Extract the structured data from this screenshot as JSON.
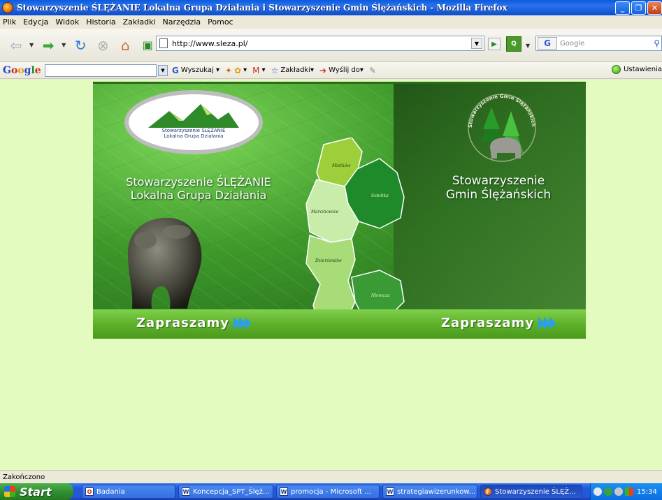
{
  "window": {
    "title": "Stowarzyszenie ŚLĘŻANIE Lokalna Grupa Działania i Stowarzyszenie Gmin Ślężańskich - Mozilla Firefox"
  },
  "menu": [
    "Plik",
    "Edycja",
    "Widok",
    "Historia",
    "Zakładki",
    "Narzędzia",
    "Pomoc"
  ],
  "navbar": {
    "url": "http://www.sleza.pl/",
    "search_placeholder": "Google"
  },
  "google_toolbar": {
    "logo": "Google",
    "search_label": "Wyszukaj",
    "bookmarks_label": "Zakładki",
    "send_label": "Wyślij do",
    "settings_label": "Ustawienia"
  },
  "banner": {
    "logo_text_line1": "Stowarzyszenie ŚLĘŻANIE",
    "logo_text_line2": "Lokalna  Grupa  Działania",
    "left_title_line1": "Stowarzyszenie ŚLĘŻANIE",
    "left_title_line2": "Lokalna  Grupa  Działania",
    "right_title_line1": "Stowarzyszenie",
    "right_title_line2": "Gmin Ślężańskich",
    "emblem_text": "Stowarzyszenie Gmin Ślężańskich",
    "map_labels": [
      "Mietków",
      "Sobótka",
      "Marcinowice",
      "Dzierżoniów",
      "Niemcza"
    ],
    "enter_left": "Zapraszamy",
    "enter_right": "Zapraszamy"
  },
  "status": "Zakończono",
  "taskbar": {
    "start": "Start",
    "tasks": [
      {
        "label": "Badania",
        "icon": "O"
      },
      {
        "label": "Koncepcja_SPT_Ślęż...",
        "icon": "W"
      },
      {
        "label": "promocja - Microsoft ...",
        "icon": "W"
      },
      {
        "label": "strategiawizerunkow...",
        "icon": "W"
      },
      {
        "label": "Stowarzyszenie ŚLĘŻ...",
        "icon": "F"
      }
    ],
    "clock": "15:34"
  }
}
